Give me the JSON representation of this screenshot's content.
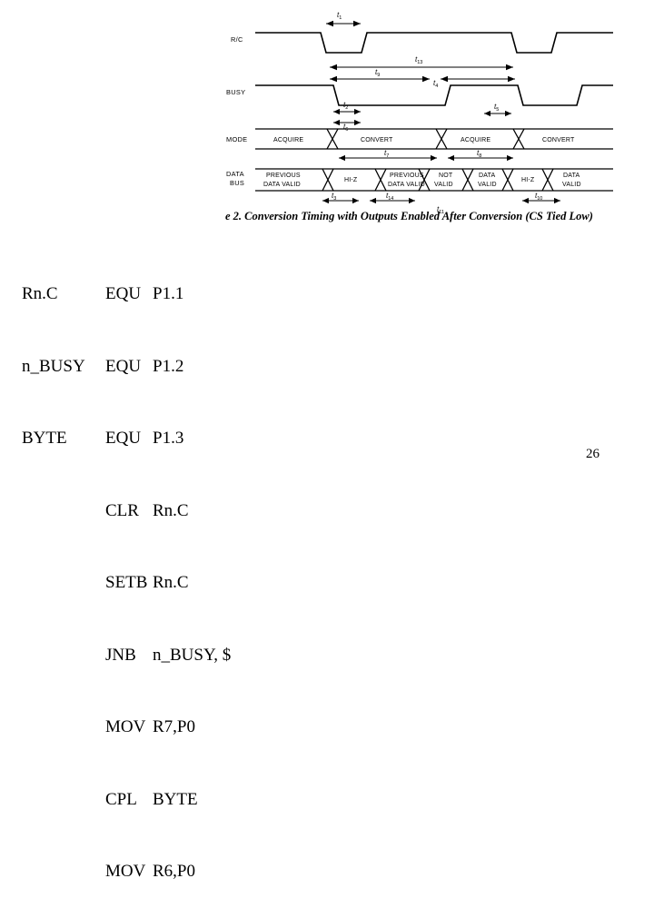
{
  "figure": {
    "caption": "e 2. Conversion Timing with Outputs Enabled After Conversion (CS Tied Low)",
    "signals": [
      {
        "name": "R/C"
      },
      {
        "name": "BUSY"
      },
      {
        "name": "MODE"
      },
      {
        "name": "DATA",
        "name2": "BUS"
      }
    ],
    "mode_blocks": [
      "ACQUIRE",
      "CONVERT",
      "ACQUIRE",
      "CONVERT"
    ],
    "bus_blocks": [
      "PREVIOUS\nDATA VALID",
      "HI-Z",
      "PREVIOUS\nDATA VALID",
      "NOT\nVALID",
      "DATA\nVALID",
      "HI-Z",
      "DATA\nVALID"
    ],
    "bus_blocks_flat": [
      "PREVIOUS DATA VALID",
      "HI-Z",
      "PREVIOUS DATA VALID",
      "NOT VALID",
      "DATA VALID",
      "HI-Z",
      "DATA VALID"
    ],
    "time_markers": [
      "t1",
      "t13",
      "t9",
      "t4",
      "t2",
      "t6",
      "t5",
      "t7",
      "t8",
      "t3",
      "t14",
      "t10",
      "t11"
    ]
  },
  "code": {
    "lines": [
      {
        "label": "Rn.C",
        "op": "EQU",
        "arg": "P1.1",
        "indent": false
      },
      {
        "label": "n_BUSY",
        "op": "EQU",
        "arg": "P1.2",
        "indent": false
      },
      {
        "label": "BYTE",
        "op": "EQU",
        "arg": "P1.3",
        "indent": false
      },
      {
        "label": "",
        "op": "CLR",
        "arg": "Rn.C",
        "indent": true
      },
      {
        "label": "",
        "op": "SETB",
        "arg": "Rn.C",
        "indent": true
      },
      {
        "label": "",
        "op": "JNB",
        "arg": "n_BUSY, $",
        "indent": true
      },
      {
        "label": "",
        "op": "MOV",
        "arg": "R7,P0",
        "indent": true
      },
      {
        "label": "",
        "op": "CPL",
        "arg": "BYTE",
        "indent": true
      },
      {
        "label": "",
        "op": "MOV",
        "arg": "R6,P0",
        "indent": true
      }
    ]
  },
  "page": {
    "number": "26"
  }
}
